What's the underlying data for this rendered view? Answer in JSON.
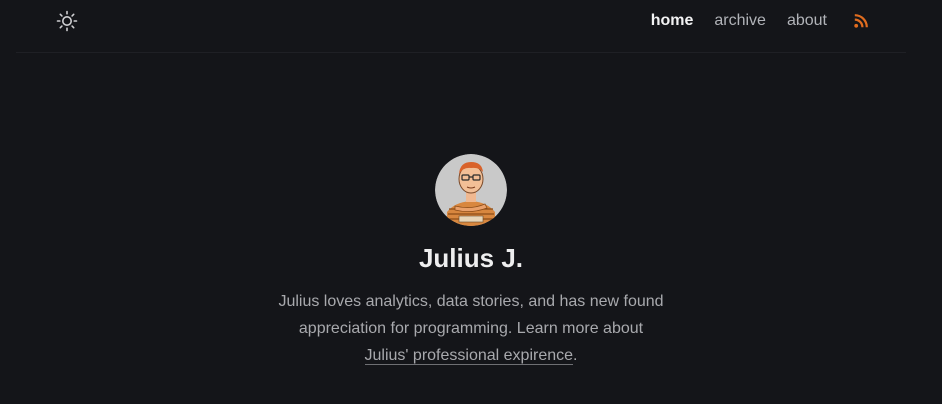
{
  "header": {
    "theme_toggle_icon": "sun-icon",
    "nav": {
      "home": "home",
      "archive": "archive",
      "about": "about"
    },
    "rss_icon": "rss-icon"
  },
  "profile": {
    "avatar_icon": "cartoon-avatar",
    "name": "Julius J.",
    "bio_line1": "Julius loves analytics, data stories, and has new found",
    "bio_line2": "appreciation for programming. Learn more about",
    "bio_link": "Julius' professional expirence",
    "bio_end": "."
  },
  "colors": {
    "background": "#141519",
    "accent_rss": "#e06c1f",
    "text": "#a8a9ad"
  }
}
